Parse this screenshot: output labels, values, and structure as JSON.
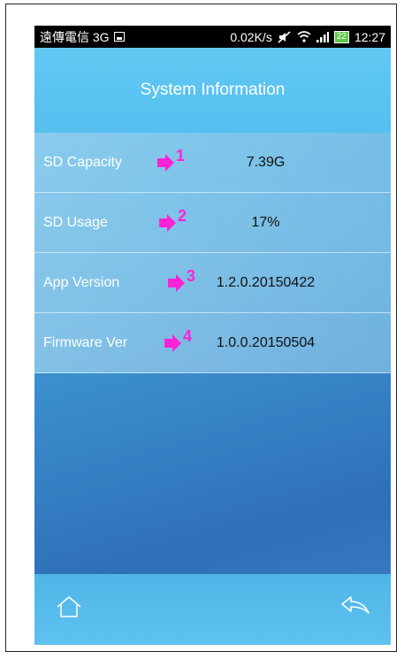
{
  "status_bar": {
    "carrier": "遠傳電信 3G",
    "speed": "0.02K/s",
    "battery": "22",
    "time": "12:27",
    "icons": [
      "image-icon",
      "mute-icon",
      "wifi-icon",
      "signal-icon",
      "battery-icon"
    ]
  },
  "header": {
    "title": "System Information"
  },
  "rows": [
    {
      "label": "SD Capacity",
      "marker": "1",
      "value": "7.39G"
    },
    {
      "label": "SD Usage",
      "marker": "2",
      "value": "17%"
    },
    {
      "label": "App Version",
      "marker": "3",
      "value": "1.2.0.20150422"
    },
    {
      "label": "Firmware Ver",
      "marker": "4",
      "value": "1.0.0.20150504"
    }
  ],
  "nav": {
    "icons": [
      "home-icon",
      "back-icon"
    ]
  },
  "colors": {
    "annotation": "#ff22d6",
    "header": "#55bff0",
    "navbar": "#5ec1ef"
  }
}
